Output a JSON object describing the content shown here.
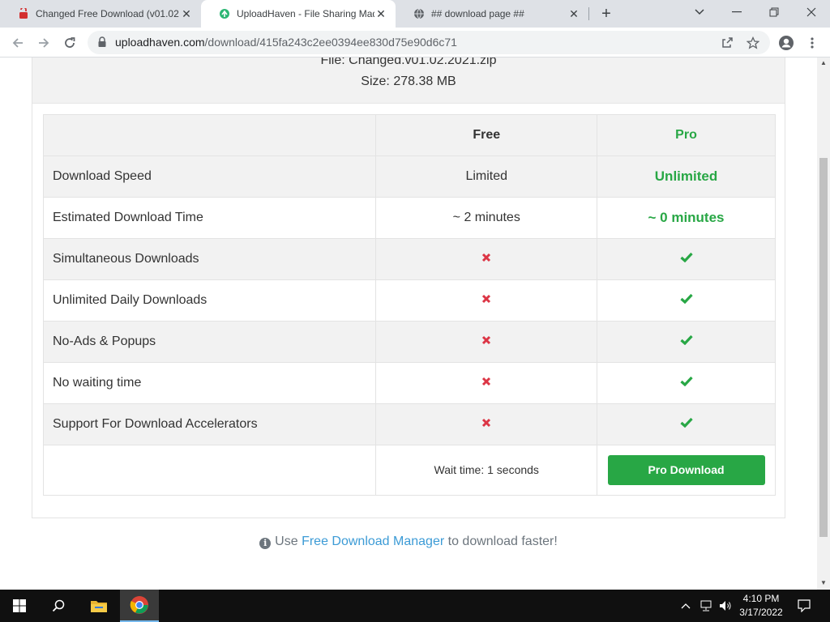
{
  "browser": {
    "tabs": [
      {
        "title": "Changed Free Download (v01.02",
        "favicon": "red-download-icon",
        "active": false
      },
      {
        "title": "UploadHaven - File Sharing Mad",
        "favicon": "uploadhaven-logo-icon",
        "active": true
      },
      {
        "title": "## download page ##",
        "favicon": "globe-icon",
        "active": false
      }
    ],
    "url_host": "uploadhaven.com",
    "url_path": "/download/415fa243c2ee0394ee830d75e90d6c71"
  },
  "page": {
    "file_name": "File: Changed.v01.02.2021.zip",
    "file_size": "Size: 278.38 MB",
    "table": {
      "headers": [
        "",
        "Free",
        "Pro"
      ],
      "rows": [
        {
          "feature": "Download Speed",
          "free": "Limited",
          "pro": "Unlimited"
        },
        {
          "feature": "Estimated Download Time",
          "free": "~ 2 minutes",
          "pro": "~ 0 minutes"
        },
        {
          "feature": "Simultaneous Downloads",
          "free": "x-mark-icon",
          "pro": "check-icon"
        },
        {
          "feature": "Unlimited Daily Downloads",
          "free": "x-mark-icon",
          "pro": "check-icon"
        },
        {
          "feature": "No-Ads & Popups",
          "free": "x-mark-icon",
          "pro": "check-icon"
        },
        {
          "feature": "No waiting time",
          "free": "x-mark-icon",
          "pro": "check-icon"
        },
        {
          "feature": "Support For Download Accelerators",
          "free": "x-mark-icon",
          "pro": "check-icon"
        }
      ],
      "wait_text": "Wait time: 1 seconds",
      "pro_button": "Pro Download"
    },
    "footer_prefix": "Use",
    "footer_link": "Free Download Manager",
    "footer_suffix": "to download faster!"
  },
  "taskbar": {
    "time": "4:10 PM",
    "date": "3/17/2022"
  },
  "colors": {
    "pro_green": "#28a745",
    "cross_red": "#dc3545",
    "link_blue": "#3c9bd6",
    "header_gray": "#f2f2f2"
  }
}
